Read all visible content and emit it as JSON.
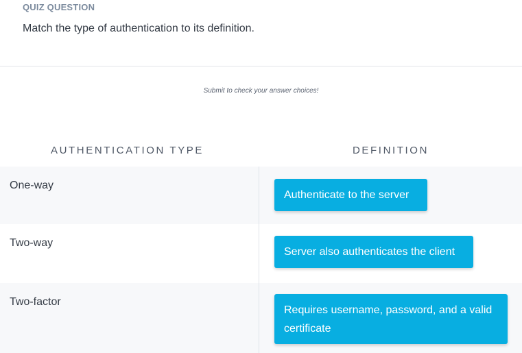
{
  "quiz": {
    "label": "QUIZ QUESTION",
    "question": "Match the type of authentication to its definition."
  },
  "hint": "Submit to check your answer choices!",
  "columns": {
    "left": "AUTHENTICATION TYPE",
    "right": "DEFINITION"
  },
  "rows": [
    {
      "type": "One-way",
      "definition": "Authenticate to the server"
    },
    {
      "type": "Two-way",
      "definition": "Server also authenticates the client"
    },
    {
      "type": "Two-factor",
      "definition": "Requires username, password, and a valid certificate"
    }
  ],
  "colors": {
    "answer_bg": "#08aee1",
    "row_shade": "#f7f8fa",
    "label": "#7b8a9d"
  }
}
